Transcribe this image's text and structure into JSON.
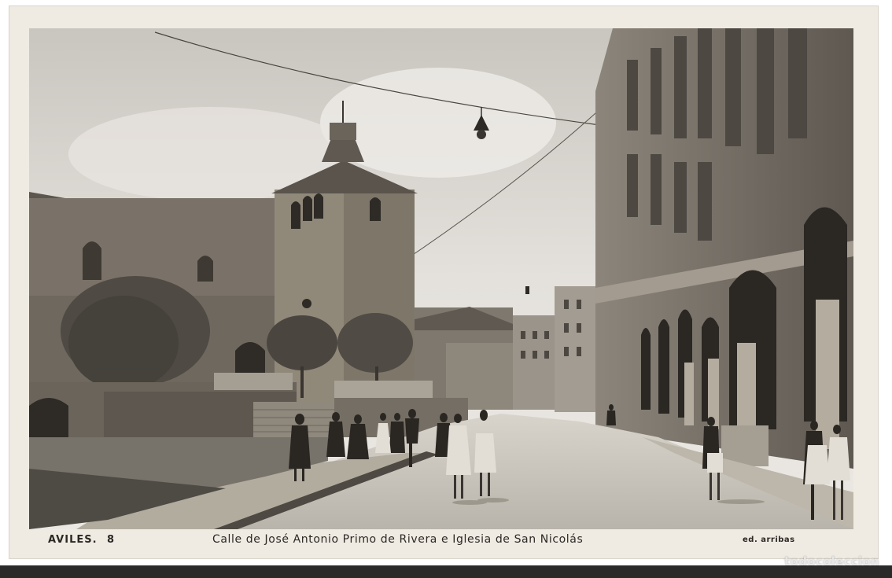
{
  "postcard": {
    "city_label": "AVILES.",
    "number_label": "8",
    "caption": "Calle de José Antonio Primo de Rivera e Iglesia de San Nicolás",
    "publisher": "ed. arribas"
  },
  "watermark": {
    "text": "todocoleccion"
  },
  "photo": {
    "tone": "sepia black-and-white",
    "colors": {
      "paper": "#efebe3",
      "sky": "#dcd8d2",
      "stone": "#7a736a",
      "street": "#c9c4bb",
      "grass": "#6e6a60",
      "shadow": "#3a3530"
    }
  }
}
